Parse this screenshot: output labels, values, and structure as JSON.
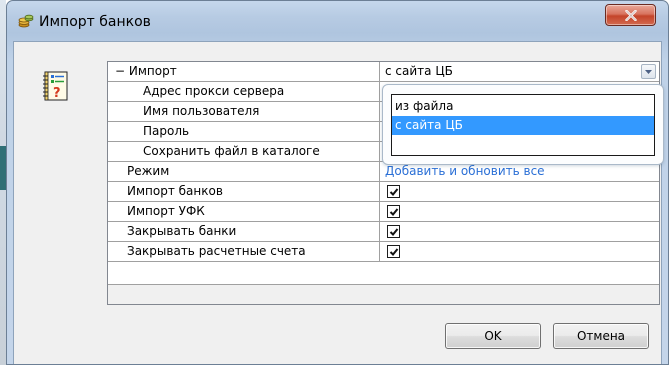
{
  "window": {
    "title": "Импорт банков",
    "close_label": "X"
  },
  "grid": {
    "rows": [
      {
        "label": "− Импорт",
        "value": "с сайта ЦБ"
      },
      {
        "label": "Адрес прокси сервера",
        "value": ""
      },
      {
        "label": "Имя пользователя",
        "value": ""
      },
      {
        "label": "Пароль",
        "value": ""
      },
      {
        "label": "Сохранить файл в каталоге",
        "value": ""
      },
      {
        "label": "Режим",
        "value": "Добавить и обновить все"
      },
      {
        "label": "Импорт банков",
        "checked": true
      },
      {
        "label": "Импорт УФК",
        "checked": true
      },
      {
        "label": "Закрывать банки",
        "checked": true
      },
      {
        "label": "Закрывать расчетные счета",
        "checked": true
      }
    ]
  },
  "dropdown": {
    "options": [
      "из файла",
      "с сайта ЦБ"
    ],
    "selected": "с сайта ЦБ"
  },
  "buttons": {
    "ok": "OK",
    "cancel": "Отмена"
  },
  "colors": {
    "selection": "#3399ff",
    "link": "#2a6fd6",
    "close_button": "#c4442a"
  }
}
